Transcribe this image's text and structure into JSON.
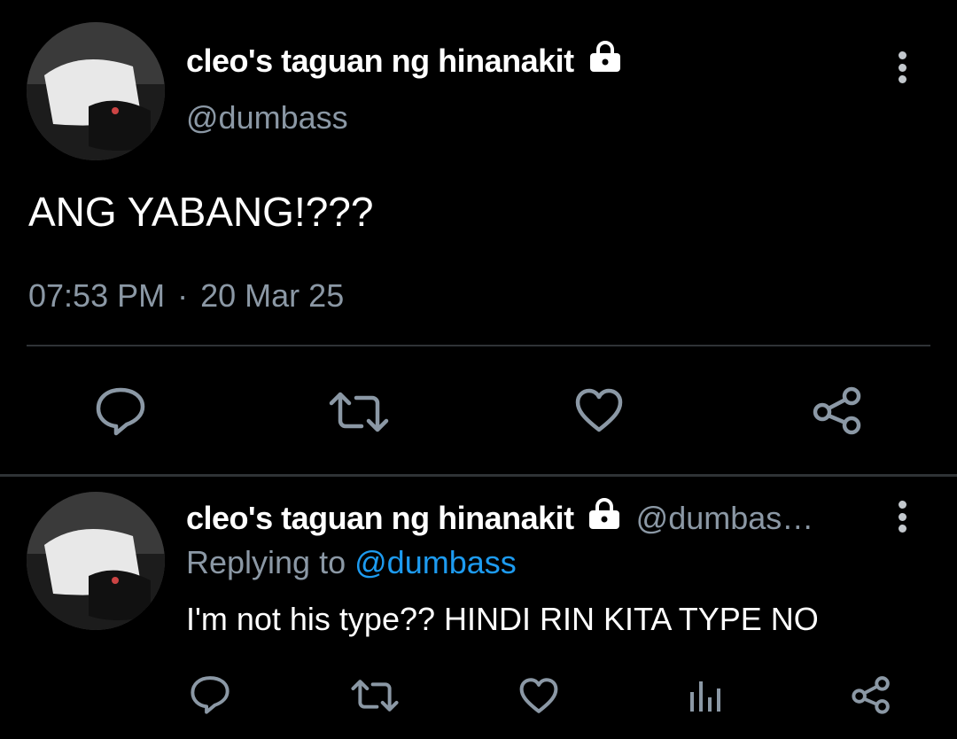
{
  "tweet": {
    "display_name": "cleo's taguan ng hinanakit",
    "handle": "@dumbass",
    "text": "ANG YABANG!???",
    "time": "07:53 PM",
    "separator": "·",
    "date": "20 Mar 25",
    "icons": {
      "lock": "lock-icon",
      "more": "more-vertical-icon",
      "reply": "reply-icon",
      "retweet": "retweet-icon",
      "like": "heart-icon",
      "share": "share-icon"
    }
  },
  "reply": {
    "display_name": "cleo's taguan ng hinanakit",
    "handle_truncated": "@dumbas…",
    "replying_to_prefix": "Replying to",
    "replying_to_handle": "@dumbass",
    "text": "I'm not his type?? HINDI RIN KITA TYPE NO",
    "icons": {
      "reply": "reply-icon",
      "retweet": "retweet-icon",
      "like": "heart-icon",
      "analytics": "analytics-icon",
      "share": "share-icon"
    }
  },
  "colors": {
    "background": "#000000",
    "text_primary": "#ffffff",
    "text_secondary": "#8b98a5",
    "link": "#1d9bf0",
    "divider": "#2f3336"
  }
}
